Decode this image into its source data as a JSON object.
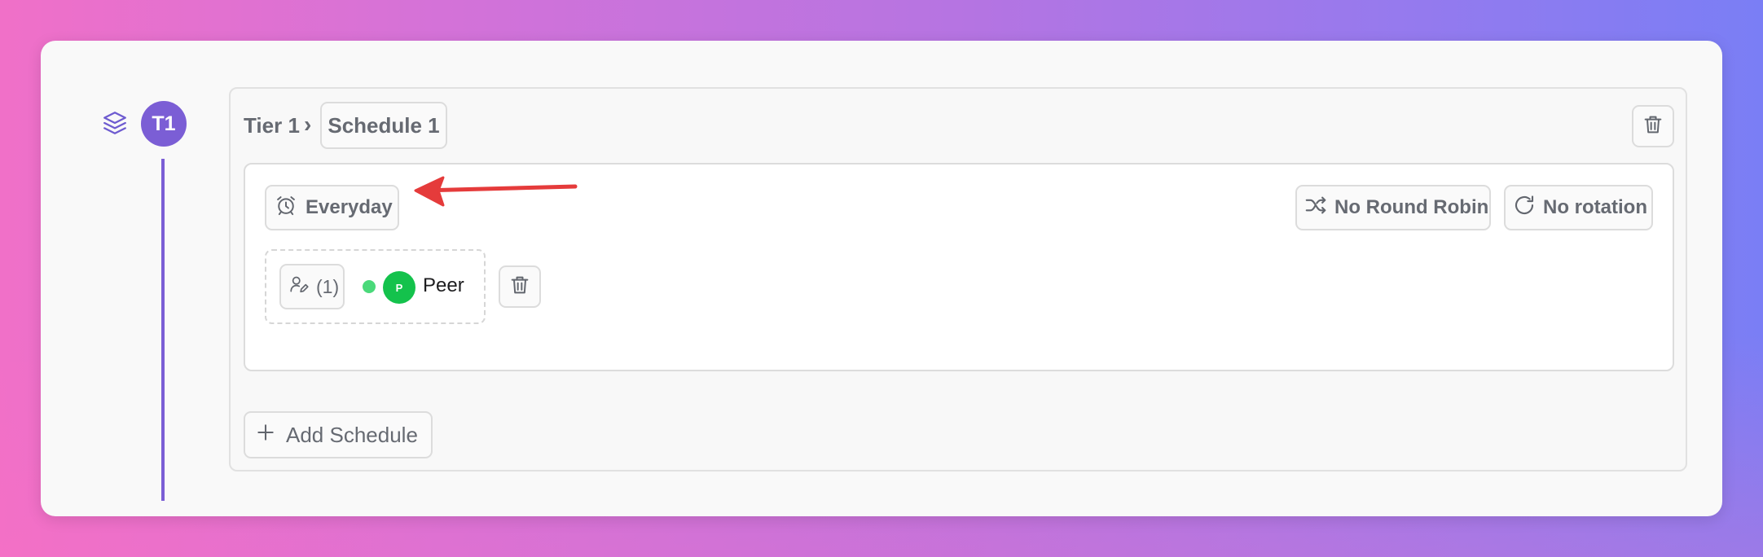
{
  "tier": {
    "badge": "T1",
    "breadcrumb_tier": "Tier 1",
    "breadcrumb_separator": "›",
    "schedule_tab": "Schedule 1"
  },
  "schedule": {
    "days_label": "Everyday",
    "round_robin_label": "No Round Robin",
    "rotation_label": "No rotation",
    "assign_count": "(1)",
    "member": {
      "initial": "P",
      "name": "Peer",
      "status": "online"
    }
  },
  "add_schedule_label": "Add Schedule",
  "icons": {
    "tier_side": "layers-icon",
    "delete": "trash-icon",
    "days": "alarm-clock-icon",
    "round_robin": "shuffle-icon",
    "rotation": "rotate-icon",
    "assign": "user-edit-icon",
    "add": "plus-icon"
  },
  "colors": {
    "accent": "#7b5ed5",
    "annotation_arrow": "#e53b3b",
    "status_online": "#4ad97a",
    "avatar": "#14c24c"
  }
}
